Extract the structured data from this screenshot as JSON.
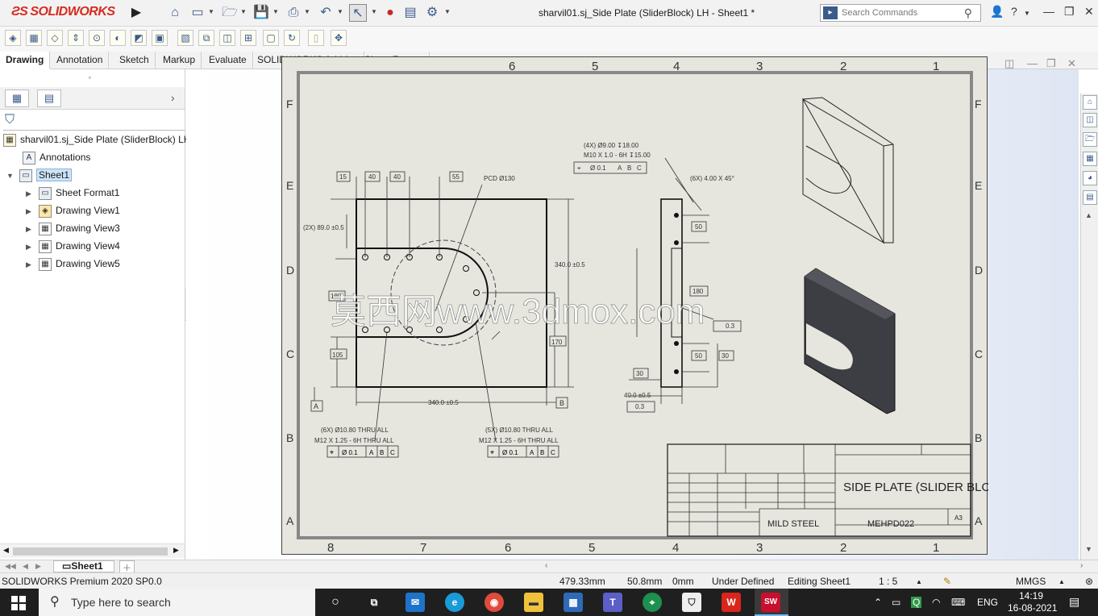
{
  "app": {
    "logo_text": "SOLIDWORKS",
    "window_title": "sharvil01.sj_Side Plate (SliderBlock) LH - Sheet1 *",
    "search_placeholder": "Search Commands"
  },
  "tabs": [
    "Drawing",
    "Annotation",
    "Sketch",
    "Markup",
    "Evaluate",
    "SOLIDWORKS Add-Ins",
    "Sheet Format"
  ],
  "active_tab": "Drawing",
  "feature_tree": {
    "root": "sharvil01.sj_Side Plate (SliderBlock) LH",
    "annotations": "Annotations",
    "sheet": "Sheet1",
    "children": [
      "Sheet Format1",
      "Drawing View1",
      "Drawing View3",
      "Drawing View4",
      "Drawing View5"
    ]
  },
  "sheet_tabs": {
    "active": "Sheet1"
  },
  "drawing": {
    "zone_cols_top": [
      "6",
      "5",
      "4",
      "3",
      "2",
      "1"
    ],
    "zone_cols_bottom": [
      "8",
      "7",
      "6",
      "5",
      "4",
      "3",
      "2",
      "1"
    ],
    "zone_rows": [
      "F",
      "E",
      "D",
      "C",
      "B",
      "A"
    ],
    "dims_top": [
      "15",
      "40",
      "40",
      "55"
    ],
    "pcd": "PCD Ø130",
    "dim_left_top": "(2X) 89.0 ±0.5",
    "dim_height": "340.0 ±0.5",
    "dim_width": "340.0 ±0.5",
    "dim_105": "105",
    "dim_170": "170",
    "dim_180": "180",
    "hole_note_left": [
      "(6X) Ø10.80 THRU ALL",
      "M12 X 1.25 - 6H THRU ALL"
    ],
    "hole_note_right": [
      "(5X) Ø10.80 THRU ALL",
      "M12 X 1.25 - 6H THRU ALL"
    ],
    "hole_note_side": [
      "(4X) Ø9.00 ↧18.00",
      "M10 X 1.0 - 6H ↧15.00"
    ],
    "chamfer": "(6X) 4.00 X 45°",
    "fcf": [
      "⌖",
      "Ø 0.1",
      "A",
      "B",
      "C"
    ],
    "side_dims": [
      "50",
      "180",
      "50",
      "30",
      "30"
    ],
    "side_thk": "40.0 ±0.5",
    "flatness": "0.3",
    "datums": [
      "A",
      "B"
    ],
    "watermark": "莫西网www.3dmox.com",
    "title_block": {
      "title": "SIDE PLATE (SLIDER BLOCK) (LH)",
      "material": "MILD STEEL",
      "dwg_no": "MEHPD022",
      "size": "A3"
    }
  },
  "status": {
    "product": "SOLIDWORKS Premium 2020 SP0.0",
    "x": "479.33mm",
    "y": "50.8mm",
    "z": "0mm",
    "state": "Under Defined",
    "editing": "Editing Sheet1",
    "scale": "1 : 5",
    "units": "MMGS"
  },
  "taskbar": {
    "search": "Type here to search",
    "lang": "ENG",
    "time": "14:19",
    "date": "16-08-2021"
  }
}
